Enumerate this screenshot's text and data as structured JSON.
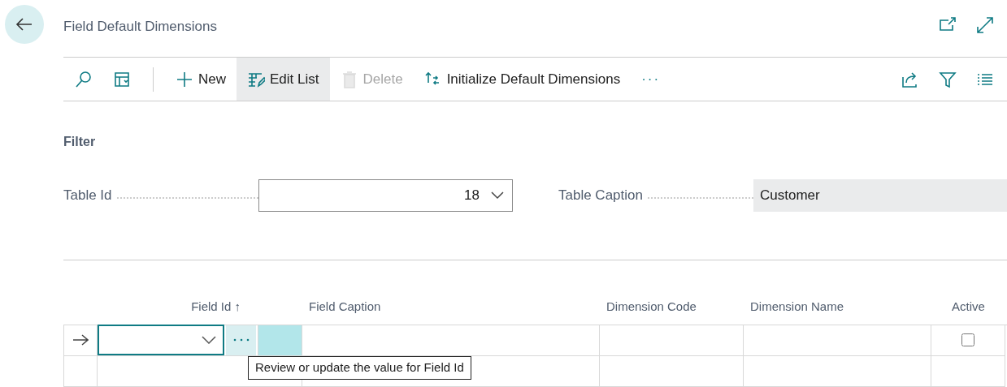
{
  "page": {
    "title": "Field Default Dimensions"
  },
  "toolbar": {
    "actions": [
      {
        "kind": "search",
        "disabled": false,
        "selected": false
      },
      {
        "kind": "layout",
        "disabled": false,
        "selected": false
      },
      {
        "kind": "new",
        "label": "New",
        "disabled": false,
        "selected": false
      },
      {
        "kind": "edit",
        "label": "Edit List",
        "disabled": false,
        "selected": true
      },
      {
        "kind": "delete",
        "label": "Delete",
        "disabled": true,
        "selected": false
      },
      {
        "kind": "initialize",
        "label": "Initialize Default Dimensions",
        "disabled": false,
        "selected": false
      },
      {
        "kind": "more",
        "label": "···",
        "disabled": false,
        "selected": false
      }
    ]
  },
  "filter": {
    "heading": "Filter",
    "fields": [
      {
        "kind": "dropdown",
        "label": "Table Id",
        "value": "18"
      },
      {
        "kind": "readonly",
        "label": "Table Caption",
        "value": "Customer"
      }
    ]
  },
  "table": {
    "columns": [
      "Field Id ↑",
      "Field Caption",
      "Dimension Code",
      "Dimension Name",
      "Active"
    ],
    "rows": [
      {
        "current": true,
        "active": false
      },
      {
        "current": false
      }
    ]
  },
  "tooltip": {
    "text": "Review or update the value for Field Id"
  }
}
